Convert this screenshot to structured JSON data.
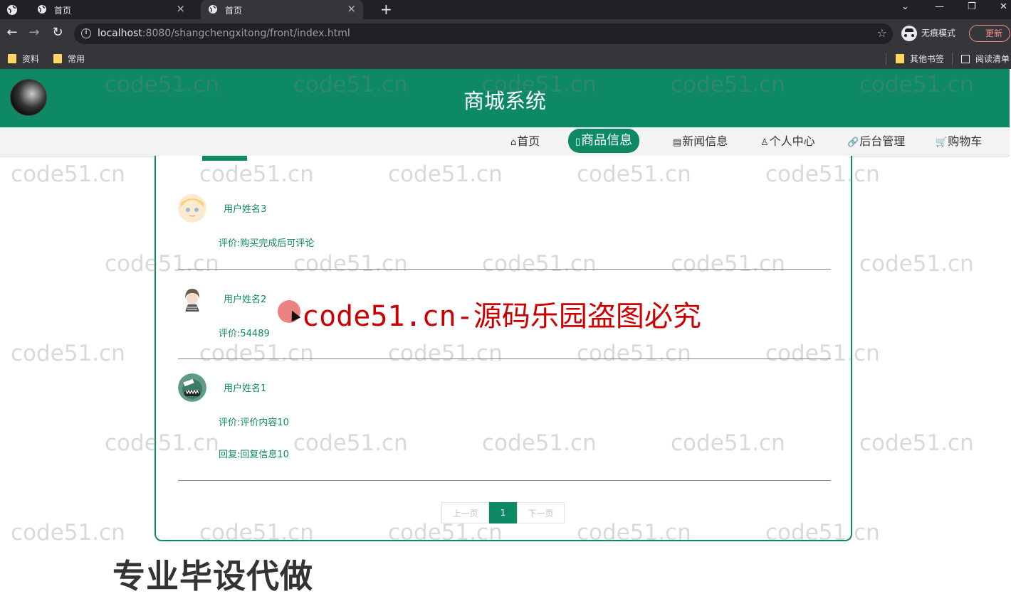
{
  "browser": {
    "tabs": [
      {
        "title": "首页",
        "close": "×"
      },
      {
        "title": "首页",
        "close": "×"
      }
    ],
    "new_tab": "+",
    "window_controls": {
      "dropdown": "⌄",
      "minimize": "—",
      "restore": "❐",
      "close": "✕"
    },
    "url_host": "localhost",
    "url_rest": ":8080/shangchengxitong/front/index.html",
    "incognito_label": "无痕模式",
    "update_label": "更新",
    "bookmarks": [
      {
        "label": "资料",
        "icon": "folder-icon"
      },
      {
        "label": "常用",
        "icon": "folder-icon"
      }
    ],
    "bookmarks_right": [
      {
        "label": "其他书签",
        "icon": "folder-icon"
      },
      {
        "label": "阅读清单",
        "icon": "reading-list-icon"
      }
    ]
  },
  "site": {
    "title": "商城系统",
    "nav": [
      {
        "icon": "⌂",
        "label": "首页"
      },
      {
        "icon": "▯",
        "label": "商品信息"
      },
      {
        "icon": "▤",
        "label": "新闻信息"
      },
      {
        "icon": "♙",
        "label": "个人中心"
      },
      {
        "icon": "🔗",
        "label": "后台管理"
      },
      {
        "icon": "🛒",
        "label": "购物车"
      }
    ]
  },
  "comments": [
    {
      "user": "用户姓名3",
      "content": "评价:购买完成后可评论",
      "reply": ""
    },
    {
      "user": "用户姓名2",
      "content": "评价:54489",
      "reply": ""
    },
    {
      "user": "用户姓名1",
      "content": "评价:评价内容10",
      "reply": "回复:回复信息10"
    }
  ],
  "pager": {
    "prev": "上一页",
    "current": "1",
    "next": "下一页"
  },
  "overlay": {
    "watermark": "code51.cn",
    "banner": "code51.cn-源码乐园盗图必究",
    "bottom_text": "专业毕设代做"
  },
  "colors": {
    "brand": "#0d8a63",
    "banner": "#cc0000"
  }
}
